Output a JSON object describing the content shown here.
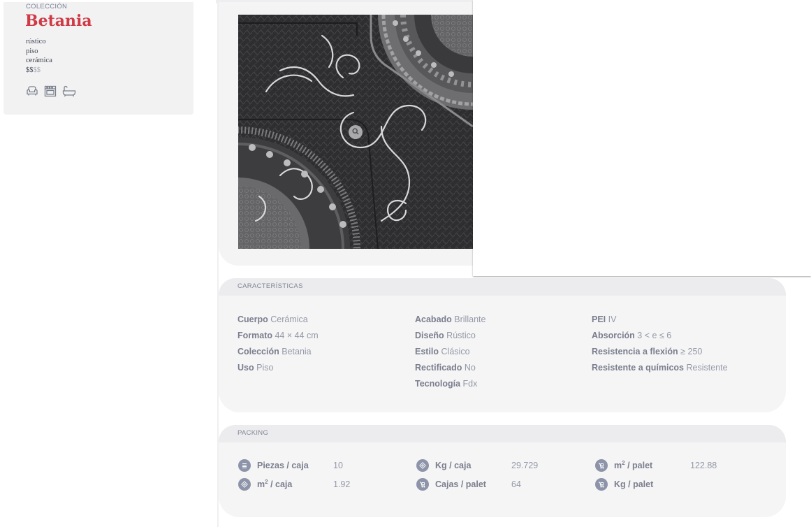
{
  "collection": {
    "kicker": "COLECCIÓN",
    "name": "Betania",
    "tags": [
      "rústico",
      "piso",
      "cerámica"
    ],
    "price_active": "$$",
    "price_inactive": "$$",
    "use_icons": [
      "sofa-icon",
      "kitchen-icon",
      "bathtub-icon"
    ]
  },
  "product_image": {
    "zoom_icon": "magnifier-icon"
  },
  "characteristics": {
    "header": "CARACTERÍSTICAS",
    "col1": [
      {
        "label": "Cuerpo",
        "value": "Cerámica"
      },
      {
        "label": "Formato",
        "value": "44 × 44 cm"
      },
      {
        "label": "Colección",
        "value": "Betania"
      },
      {
        "label": "Uso",
        "value": "Piso"
      }
    ],
    "col2": [
      {
        "label": "Acabado",
        "value": "Brillante"
      },
      {
        "label": "Diseño",
        "value": "Rústico"
      },
      {
        "label": "Estilo",
        "value": "Clásico"
      },
      {
        "label": "Rectificado",
        "value": "No"
      },
      {
        "label": "Tecnología",
        "value": "Fdx"
      }
    ],
    "col3": [
      {
        "label": "PEI",
        "value": "IV"
      },
      {
        "label": "Absorción",
        "value": "3 < e ≤ 6"
      },
      {
        "label": "Resistencia a flexión",
        "value": "≥ 250"
      },
      {
        "label": "Resistente a químicos",
        "value": "Resistente"
      }
    ]
  },
  "packing": {
    "header": "PACKING",
    "items": {
      "piezas_caja": {
        "label": "Piezas / caja",
        "value": "10",
        "icon": "stack-icon"
      },
      "m2_caja": {
        "label": "/ caja",
        "unit": "m",
        "exp": "2",
        "value": "1.92",
        "icon": "tile-icon"
      },
      "kg_caja": {
        "label": "Kg / caja",
        "value": "29.729",
        "icon": "tile-icon"
      },
      "cajas_palet": {
        "label": "Cajas / palet",
        "value": "64",
        "icon": "pallet-cart-icon"
      },
      "m2_palet": {
        "label": "/ palet",
        "unit": "m",
        "exp": "2",
        "value": "122.88",
        "icon": "pallet-cart-icon"
      },
      "kg_palet": {
        "label": "Kg / palet",
        "value": "",
        "icon": "pallet-cart-icon"
      }
    }
  },
  "colors": {
    "accent_red": "#cf3a45",
    "label_gray": "#7a7e8d",
    "value_gray": "#9499a6",
    "icon_circle": "#8d93a8"
  }
}
